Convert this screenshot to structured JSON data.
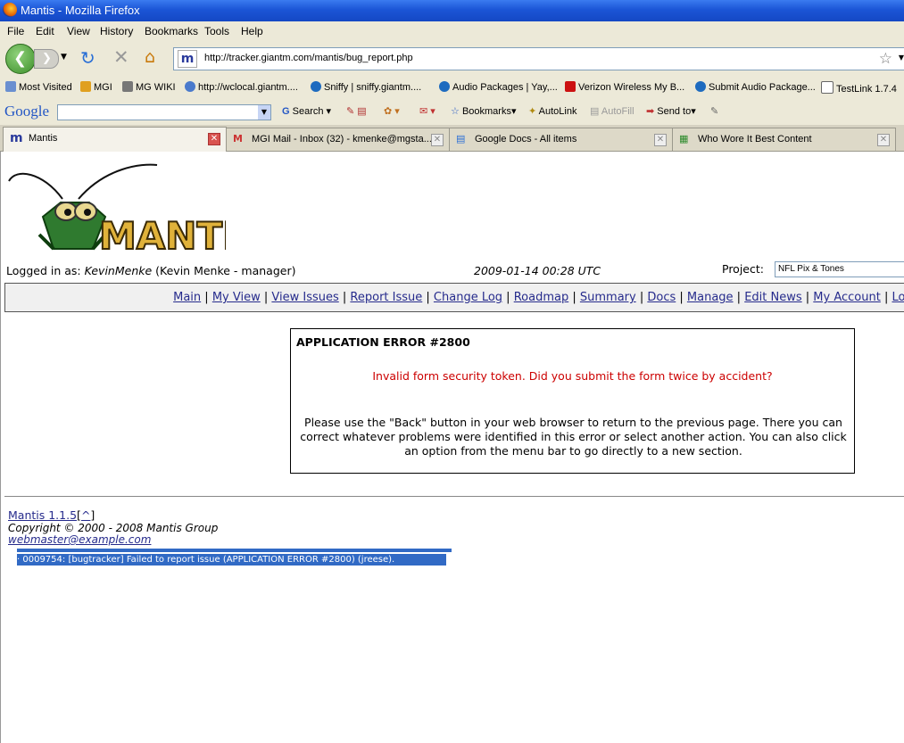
{
  "window": {
    "title": "Mantis - Mozilla Firefox"
  },
  "menu": [
    "File",
    "Edit",
    "View",
    "History",
    "Bookmarks",
    "Tools",
    "Help"
  ],
  "url": "http://tracker.giantm.com/mantis/bug_report.php",
  "bookmarks": [
    "Most Visited",
    "MGI",
    "MG WIKI",
    "http://wclocal.giantm....",
    "Sniffy | sniffy.giantm....",
    "Audio Packages | Yay,...",
    "Verizon Wireless My B...",
    "Submit Audio Package...",
    "TestLink 1.7.4"
  ],
  "google_bar": {
    "logo": "Google",
    "search": "Search",
    "bookmarks": "Bookmarks",
    "autolink": "AutoLink",
    "autofill": "AutoFill",
    "sendto": "Send to"
  },
  "tabs": [
    {
      "label": "Mantis",
      "active": true
    },
    {
      "label": "MGI Mail - Inbox (32) - kmenke@mgsta...",
      "active": false
    },
    {
      "label": "Google Docs - All items",
      "active": false
    },
    {
      "label": "Who Wore It Best Content",
      "active": false
    }
  ],
  "page": {
    "logo_text": "MANTIS",
    "logged_in_label": "Logged in as:",
    "username": "KevinMenke",
    "user_detail": "(Kevin Menke - manager)",
    "datetime": "2009-01-14 00:28 UTC",
    "project_label": "Project:",
    "project_value": "NFL Pix & Tones",
    "nav": [
      "Main",
      "My View",
      "View Issues",
      "Report Issue",
      "Change Log",
      "Roadmap",
      "Summary",
      "Docs",
      "Manage",
      "Edit News",
      "My Account",
      "Logout"
    ],
    "error": {
      "title": "APPLICATION ERROR #2800",
      "message": "Invalid form security token. Did you submit the form twice by accident?",
      "help": "Please use the \"Back\" button in your web browser to return to the previous page. There you can correct whatever problems were identified in this error or select another action. You can also click an option from the menu bar to go directly to a new section."
    },
    "footer": {
      "version": "Mantis 1.1.5",
      "up": "^",
      "copyright": "Copyright © 2000 - 2008 Mantis Group",
      "email": "webmaster@example.com"
    },
    "selected_text": "· 0009754: [bugtracker] Failed to report issue (APPLICATION ERROR #2800) (jreese)."
  }
}
